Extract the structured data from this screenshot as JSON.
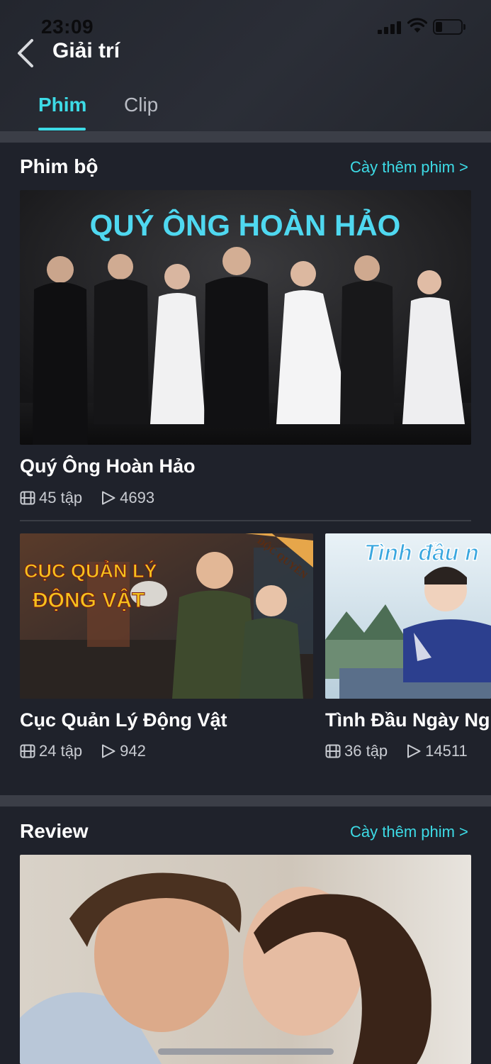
{
  "status_bar": {
    "time": "23:09"
  },
  "header": {
    "title": "Giải trí"
  },
  "tabs": [
    {
      "label": "Phim",
      "active": true
    },
    {
      "label": "Clip",
      "active": false
    }
  ],
  "sections": {
    "phim_bo": {
      "title": "Phim bộ",
      "more_label": "Cày thêm phim >",
      "featured": {
        "poster_title": "QUÝ ÔNG HOÀN HẢO",
        "title": "Quý Ông Hoàn Hảo",
        "episodes": "45 tập",
        "views": "4693"
      },
      "items": [
        {
          "poster_title_line1": "CỤC QUẢN LÝ",
          "poster_title_line2": "ĐỘNG VẬT",
          "badge": "ĐỘC QUYỀN",
          "title": "Cục Quản Lý Động Vật",
          "episodes": "24 tập",
          "views": "942"
        },
        {
          "poster_title": "Tình đầu n",
          "title": "Tình Đầu Ngày Ng",
          "episodes": "36 tập",
          "views": "14511"
        }
      ]
    },
    "review": {
      "title": "Review",
      "more_label": "Cày thêm phim >"
    }
  },
  "colors": {
    "accent": "#3ddbe6",
    "background": "#1f222b",
    "divider": "#3b3e47",
    "poster_title_gold": "#f4c21e"
  }
}
